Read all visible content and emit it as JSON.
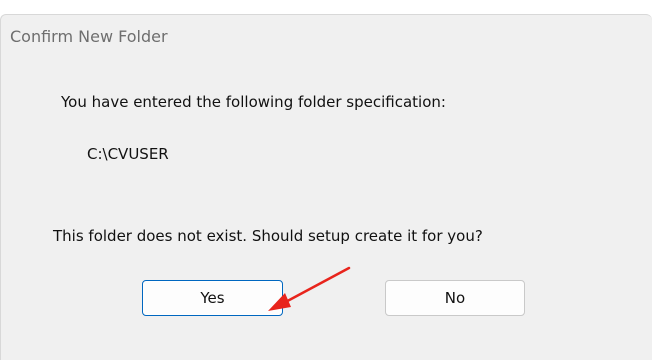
{
  "window": {
    "title": "Confirm New Folder"
  },
  "message": {
    "line1": "You have entered the following folder specification:",
    "folder_path": "C:\\CVUSER",
    "question": "This folder does not exist.  Should setup create it for you?"
  },
  "buttons": {
    "yes_label": "Yes",
    "no_label": "No"
  },
  "annotation": {
    "arrow_color": "#e8241c",
    "points_to": "yes-button"
  },
  "colors": {
    "dialog_background": "#f0f0f0",
    "default_button_border": "#0067c0",
    "title_text": "#6e6e6e"
  }
}
